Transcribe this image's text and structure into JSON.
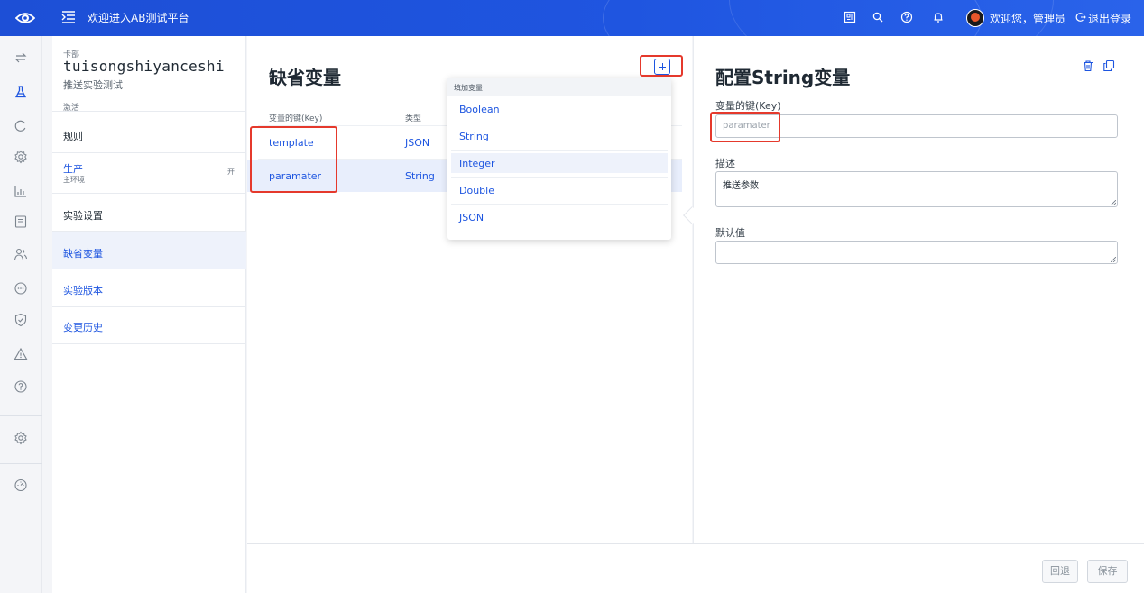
{
  "topbar": {
    "title": "欢迎进入AB测试平台",
    "welcome": "欢迎您，管理员",
    "logout": "退出登录",
    "icons": [
      "eye-logo-icon",
      "menu-fold-icon",
      "layout-icon",
      "search-icon",
      "help-icon",
      "bell-icon",
      "avatar",
      "logout-icon"
    ]
  },
  "rail": {
    "icons": [
      "swap-icon",
      "flask-icon",
      "refresh-icon",
      "gear-icon",
      "bar-chart-icon",
      "list-icon",
      "users-icon",
      "chat-icon",
      "shield-icon",
      "warning-icon",
      "help-icon",
      "settings-icon",
      "dashboard-icon"
    ]
  },
  "project": {
    "crumb": "卡部",
    "name": "tuisongshiyanceshi",
    "description": "推送实验测试",
    "status": "激活",
    "nav": {
      "rules": "规则",
      "env_name": "生产",
      "env_sub": "主环境",
      "env_status": "开",
      "settings": "实验设置",
      "defaults": "缺省变量",
      "versions": "实验版本",
      "history": "变更历史"
    }
  },
  "variables": {
    "title": "缺省变量",
    "col_key": "变量的键(Key)",
    "col_type": "类型",
    "rows": [
      {
        "key": "template",
        "type": "JSON"
      },
      {
        "key": "paramater",
        "type": "String"
      }
    ]
  },
  "dropdown": {
    "header": "填加变量",
    "options": [
      "Boolean",
      "String",
      "Integer",
      "Double",
      "JSON"
    ]
  },
  "config": {
    "title": "配置String变量",
    "key_label": "变量的键(Key)",
    "key_placeholder": "paramater",
    "desc_label": "描述",
    "desc_value": "推送参数",
    "default_label": "默认值",
    "default_value": ""
  },
  "footer": {
    "revert": "回退",
    "save": "保存"
  },
  "colors": {
    "primary": "#1d55e0",
    "highlight": "#e5392c"
  }
}
